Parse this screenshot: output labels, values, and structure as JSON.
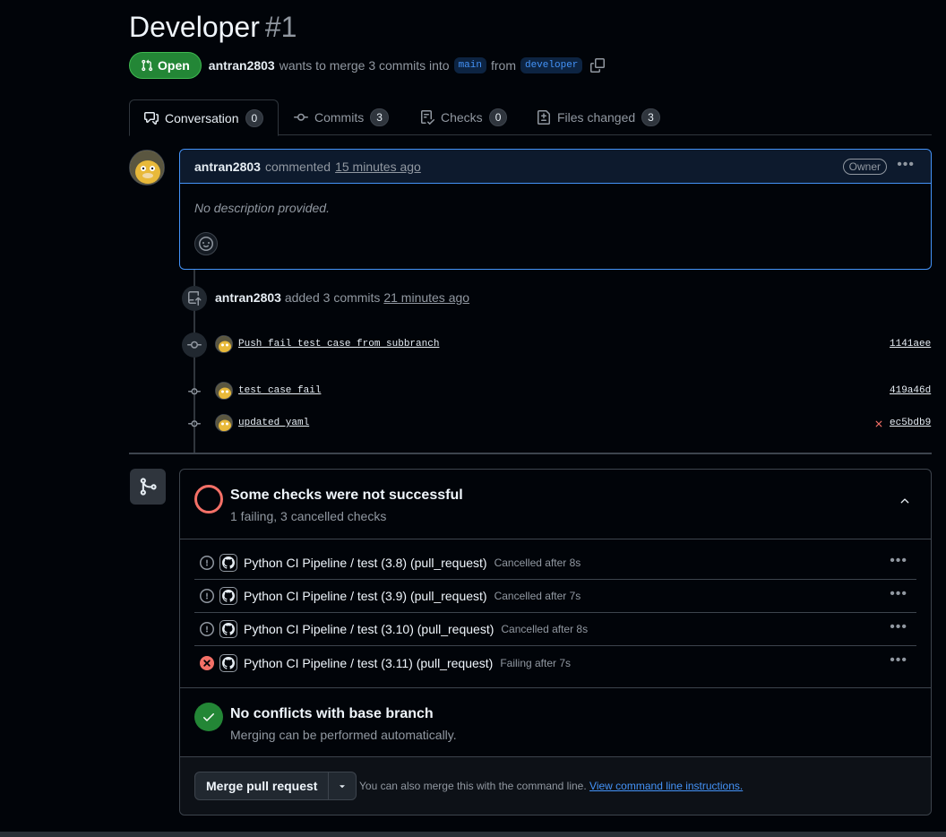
{
  "pr": {
    "title": "Developer",
    "number": "#1",
    "state": "Open",
    "author": "antran2803",
    "merge_text": "wants to merge 3 commits into",
    "base_branch": "main",
    "from_text": "from",
    "head_branch": "developer"
  },
  "tabs": [
    {
      "label": "Conversation",
      "count": "0",
      "icon": "comment-discussion-icon"
    },
    {
      "label": "Commits",
      "count": "3",
      "icon": "git-commit-icon"
    },
    {
      "label": "Checks",
      "count": "0",
      "icon": "checklist-icon"
    },
    {
      "label": "Files changed",
      "count": "3",
      "icon": "file-diff-icon"
    }
  ],
  "comment": {
    "author": "antran2803",
    "verb": "commented",
    "time": "15 minutes ago",
    "badge": "Owner",
    "body": "No description provided."
  },
  "timeline": {
    "event_author": "antran2803",
    "event_text": "added 3 commits",
    "event_time": "21 minutes ago",
    "commits": [
      {
        "message": "Push fail test case from subbranch",
        "sha": "1141aee",
        "status": ""
      },
      {
        "message": "test case fail",
        "sha": "419a46d",
        "status": ""
      },
      {
        "message": "updated yaml",
        "sha": "ec5bdb9",
        "status": "failure"
      }
    ]
  },
  "checks": {
    "title": "Some checks were not successful",
    "subtitle": "1 failing, 3 cancelled checks",
    "items": [
      {
        "name": "Python CI Pipeline / test (3.8) (pull_request)",
        "status": "Cancelled after 8s",
        "state": "cancelled"
      },
      {
        "name": "Python CI Pipeline / test (3.9) (pull_request)",
        "status": "Cancelled after 7s",
        "state": "cancelled"
      },
      {
        "name": "Python CI Pipeline / test (3.10) (pull_request)",
        "status": "Cancelled after 8s",
        "state": "cancelled"
      },
      {
        "name": "Python CI Pipeline / test (3.11) (pull_request)",
        "status": "Failing after 7s",
        "state": "failing"
      }
    ]
  },
  "conflicts": {
    "title": "No conflicts with base branch",
    "subtitle": "Merging can be performed automatically."
  },
  "merge": {
    "button": "Merge pull request",
    "hint": "You can also merge this with the command line.",
    "link": "View command line instructions."
  },
  "colors": {
    "background": "#010409",
    "accent": "#4493f8",
    "success": "#238636",
    "danger": "#f47067"
  }
}
